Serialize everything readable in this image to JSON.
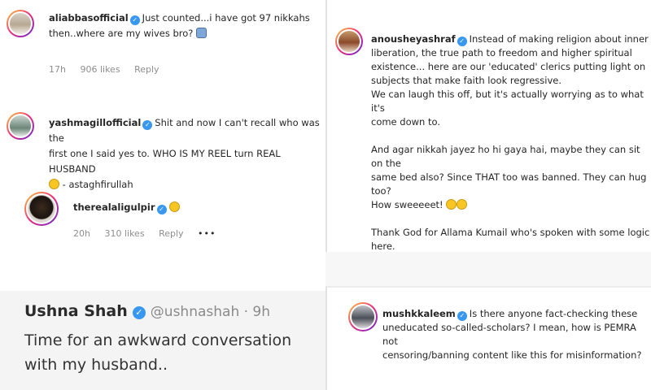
{
  "left_top": {
    "comment1": {
      "username": "aliabbasofficial",
      "text_line1": "Just counted...i have got 97 nikkahs",
      "text_line2": "then..where are my wives bro?",
      "time": "17h",
      "likes": "906 likes",
      "reply": "Reply"
    },
    "comment2": {
      "username": "yashmagillofficial",
      "text_line1": "Shit and now I can't recall who was the",
      "text_line2": "first one I said yes to. WHO IS MY REEL turn REAL HUSBAND",
      "text_line3": "- astaghfirullah"
    },
    "reply1": {
      "username": "therealaligulpir",
      "time": "20h",
      "likes": "310 likes",
      "reply": "Reply",
      "more": "•••"
    }
  },
  "right_top": {
    "username": "anousheyashraf",
    "lines": [
      "Instead of making religion about inner",
      "liberation, the true path to freedom and higher spiritual",
      "existence... here are our 'educated' clerics putting light on",
      "subjects that make faith look regressive.",
      "We can laugh this off, but it's actually worrying as to what it's",
      "come down to.",
      "",
      "And agar nikkah jayez ho hi gaya hai, maybe they can sit on the",
      "same bed also? Since THAT too was banned. They can hug too?",
      "How sweeeeet!",
      "",
      "Thank God for Allama Kumail who's spoken with some logic",
      "here."
    ]
  },
  "left_bottom": {
    "name": "Ushna Shah",
    "handle": "@ushnashah · 9h",
    "text": "Time for an awkward conversation with my husband.."
  },
  "right_bottom": {
    "username": "mushkkaleem",
    "lines": [
      "Is there anyone fact-checking these",
      "uneducated so-called-scholars? I mean, how is PEMRA not",
      "censoring/banning content like this for misinformation?"
    ]
  },
  "colors": {
    "verified": "#3897f0",
    "meta": "#8e8e8e",
    "ring": "#ee2a7b"
  }
}
